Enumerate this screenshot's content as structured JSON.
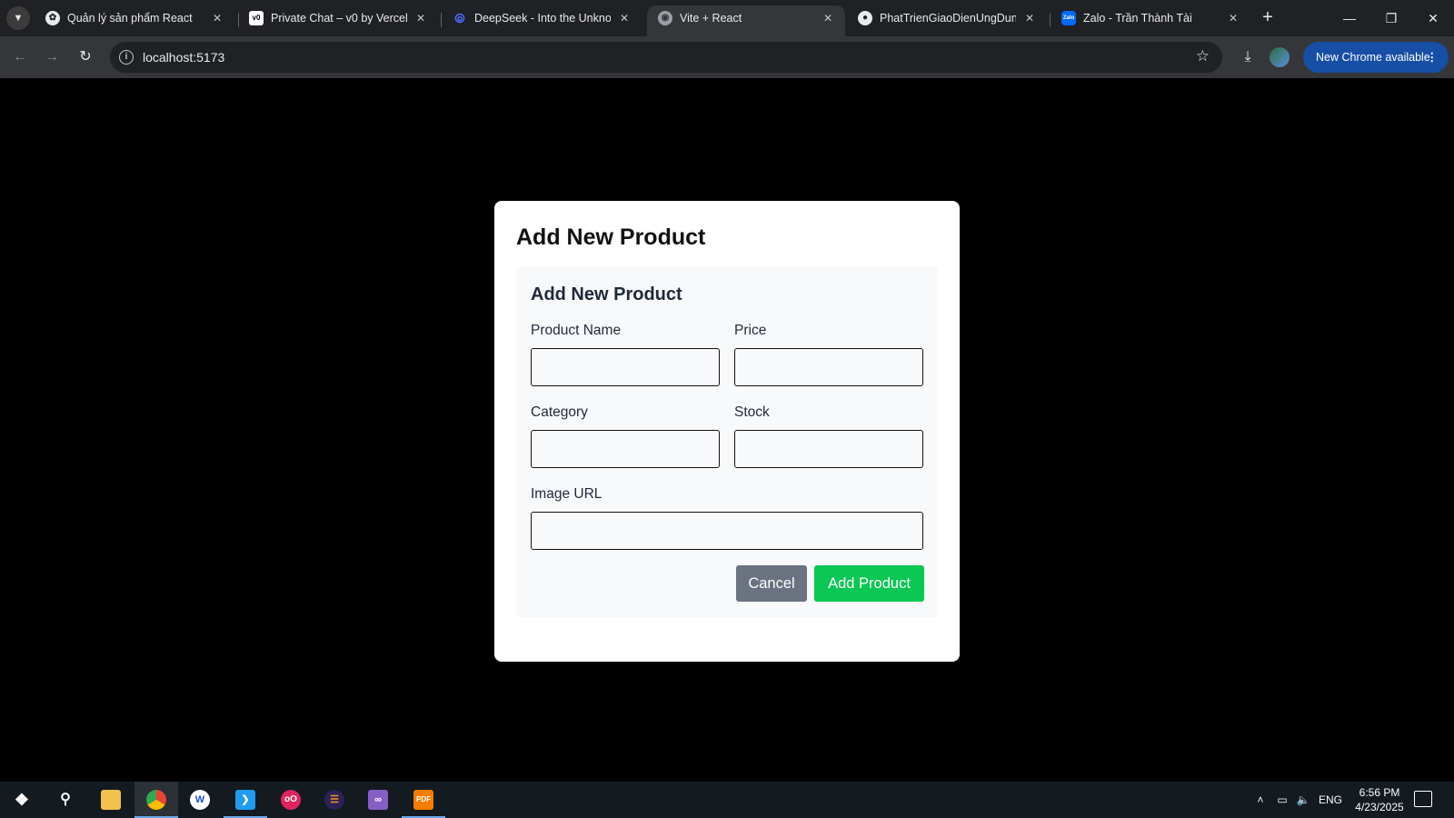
{
  "browser": {
    "tabs": [
      {
        "title": "Quản lý sản phẩm React",
        "icon": "chatgpt-icon"
      },
      {
        "title": "Private Chat – v0 by Vercel",
        "icon": "v0-icon"
      },
      {
        "title": "DeepSeek - Into the Unknown",
        "icon": "deepseek-icon"
      },
      {
        "title": "Vite + React",
        "icon": "globe-icon"
      },
      {
        "title": "PhatTrienGiaoDienUngDung",
        "icon": "github-icon"
      },
      {
        "title": "Zalo - Trần Thành Tài",
        "icon": "zalo-icon"
      }
    ],
    "active_tab_index": 3,
    "address": "localhost:5173",
    "update_label": "New Chrome available"
  },
  "modal": {
    "title": "Add New Product",
    "form": {
      "title": "Add New Product",
      "fields": {
        "product_name": {
          "label": "Product Name",
          "value": ""
        },
        "price": {
          "label": "Price",
          "value": ""
        },
        "category": {
          "label": "Category",
          "value": ""
        },
        "stock": {
          "label": "Stock",
          "value": ""
        },
        "image_url": {
          "label": "Image URL",
          "value": ""
        }
      },
      "cancel_label": "Cancel",
      "submit_label": "Add Product"
    }
  },
  "colors": {
    "cancel_button": "#6b7280",
    "submit_button": "#0bc753",
    "form_panel": "#f8f9fb"
  },
  "taskbar": {
    "apps": [
      "start-icon",
      "search-icon",
      "file-explorer-icon",
      "chrome-icon",
      "app-icon",
      "vscode-icon",
      "app-icon",
      "eclipse-icon",
      "visual-studio-icon",
      "pdf-icon"
    ],
    "language": "ENG",
    "time": "6:56 PM",
    "date": "4/23/2025"
  }
}
